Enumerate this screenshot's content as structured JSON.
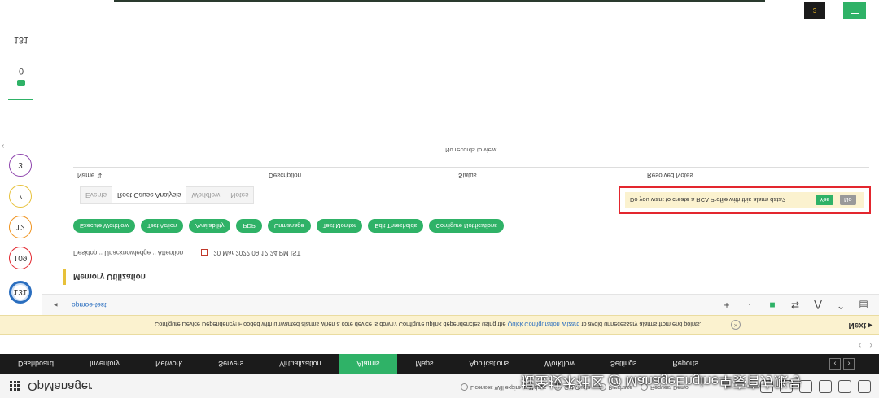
{
  "header": {
    "product": "OpManager",
    "links": [
      "Licenses Will expire in 11days",
      "Get Quote",
      "Purchase",
      "Request Demo"
    ]
  },
  "watermark": "掘金技术社区 @ ManageEngine卓豪官方账号",
  "nav": {
    "items": [
      "Dashboard",
      "Inventory",
      "Network",
      "Servers",
      "Virtualization",
      "Alarms",
      "Maps",
      "Applications",
      "Workflow",
      "Settings",
      "Reports"
    ],
    "active": "Alarms",
    "arrow_left": "‹",
    "arrow_right": "›"
  },
  "banner": {
    "text_before": "Configure Device Dependency! Flooded with unwanted alarms when a core device is down? Configure uplink dependencies using the ",
    "link": "Quick Configuration Wizard",
    "text_after": " to avoid unnecessary alarms from end points.",
    "next": "Next"
  },
  "rail": {
    "counts": [
      {
        "value": "131",
        "color": "#2a6ebf"
      },
      {
        "value": "109",
        "color": "#e3262e"
      },
      {
        "value": "12",
        "color": "#f0931e"
      },
      {
        "value": "7",
        "color": "#e7c13a"
      },
      {
        "value": "3",
        "color": "#8e44ad"
      }
    ],
    "zero": "0",
    "total": "131"
  },
  "toolbar": {
    "device": "opmoe-test"
  },
  "alarm": {
    "title": "Memory Utilization",
    "meta_status": "Desktop  ::  Unacknowledge  ::  Attention",
    "timestamp": "20 Mar 2022 09:12:24 PM IST"
  },
  "actions": [
    "Execute Workflow",
    "Test Action",
    "Availability",
    "PDP",
    "Unmanage",
    "Test Monitor",
    "Edit Thresholds",
    "Configure Notifications"
  ],
  "tabs": [
    "Events",
    "Root Cause Analysis",
    "Workflow",
    "Notes"
  ],
  "active_tab": "Root Cause Analysis",
  "rca_prompt": {
    "question": "Do you want to create a RCA Profile with this alarm data?",
    "yes": "Yes",
    "no": "No"
  },
  "table": {
    "columns": [
      "Name",
      "Description",
      "Status",
      "Resolved Notes"
    ],
    "empty_text": "No records to view."
  },
  "badge": "3",
  "colors": {
    "accent": "#2fb267",
    "highlight": "#e3262e",
    "banner": "#fbf2cf"
  }
}
